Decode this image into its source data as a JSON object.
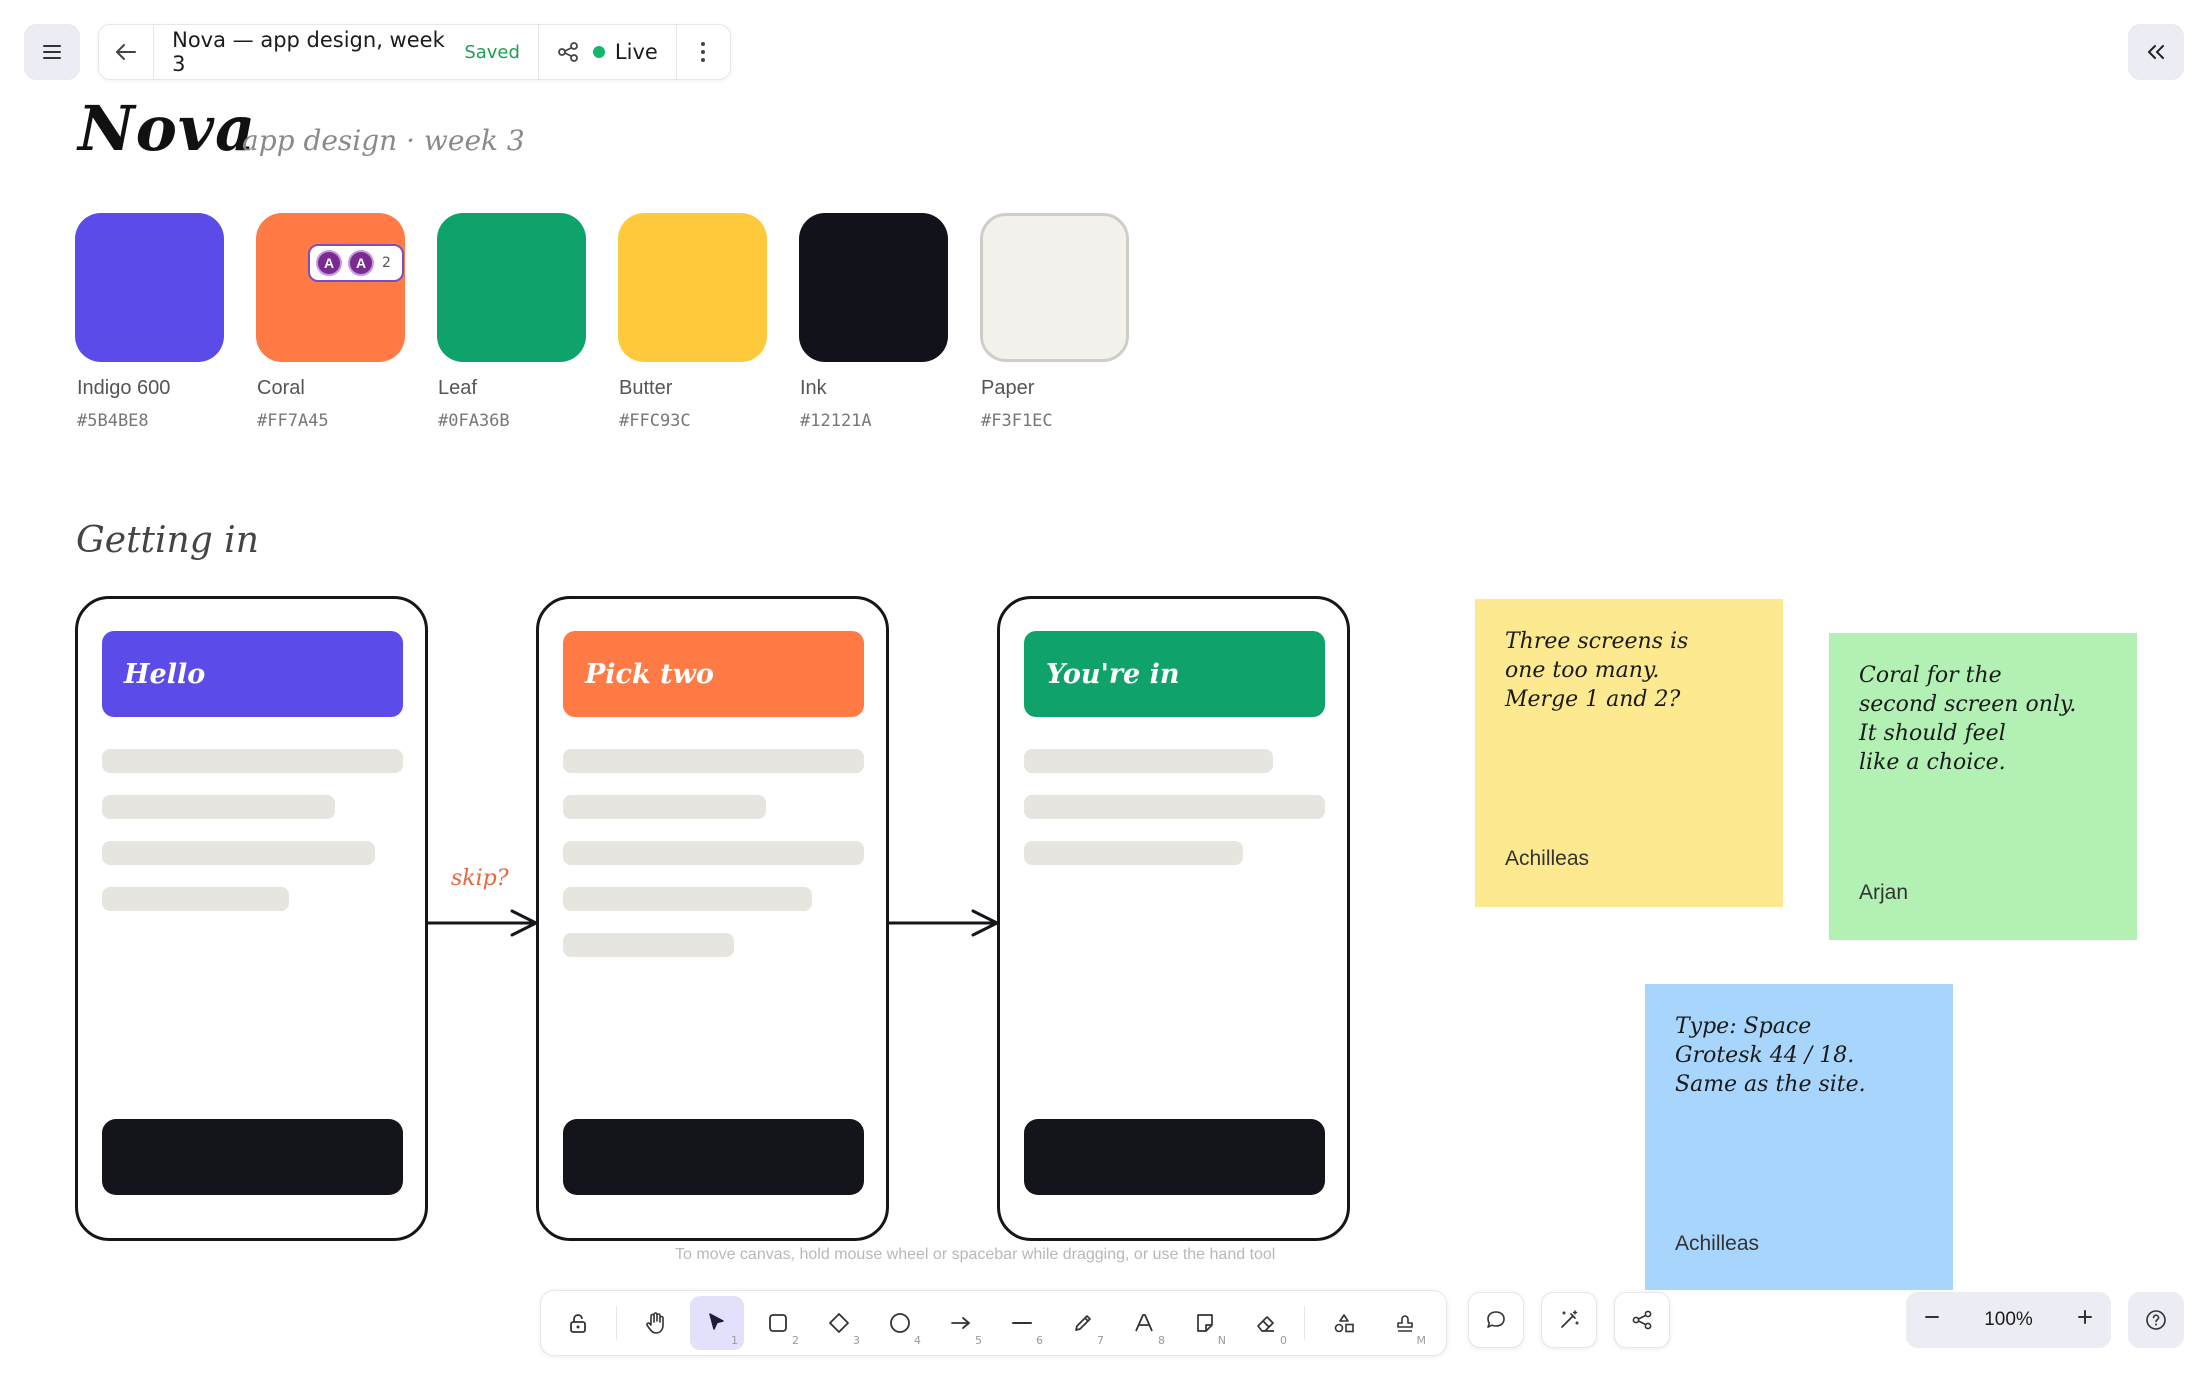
{
  "header": {
    "document_title": "Nova — app design, week 3",
    "save_status": "Saved",
    "live_label": "Live"
  },
  "canvas": {
    "title": "Nova",
    "subtitle": "app design · week 3",
    "section_heading": "Getting in",
    "swatches": [
      {
        "name": "Indigo 600",
        "hex": "#5B4BE8"
      },
      {
        "name": "Coral",
        "hex": "#FF7A45"
      },
      {
        "name": "Leaf",
        "hex": "#0FA36B"
      },
      {
        "name": "Butter",
        "hex": "#FFC93C"
      },
      {
        "name": "Ink",
        "hex": "#12121A"
      },
      {
        "name": "Paper",
        "hex": "#F3F1EC"
      }
    ],
    "collaborators": {
      "initials": [
        "A",
        "A"
      ],
      "count": "2"
    },
    "screens": [
      {
        "header": "Hello",
        "color": "#5B4BE8"
      },
      {
        "header": "Pick two",
        "color": "#FF7A45"
      },
      {
        "header": "You're in",
        "color": "#0FA36B"
      }
    ],
    "arrow_label": "skip?",
    "notes": [
      {
        "text": "Three screens is\none too many.\nMerge 1 and 2?",
        "author": "Achilleas",
        "color": "#FDE98F"
      },
      {
        "text": "Coral for the\nsecond screen only.\nIt should feel\nlike a choice.",
        "author": "Arjan",
        "color": "#B2F0B4"
      },
      {
        "text": "Type: Space\nGrotesk 44 / 18.\nSame as the site.",
        "author": "Achilleas",
        "color": "#A8D5FC"
      }
    ],
    "hint": "To move canvas, hold mouse wheel or spacebar while dragging, or use the hand tool"
  },
  "toolbar": {
    "tools": [
      {
        "icon": "lock-icon",
        "key": ""
      },
      {
        "icon": "hand-icon",
        "key": ""
      },
      {
        "icon": "pointer-icon",
        "key": "1"
      },
      {
        "icon": "rectangle-icon",
        "key": "2"
      },
      {
        "icon": "diamond-icon",
        "key": "3"
      },
      {
        "icon": "ellipse-icon",
        "key": "4"
      },
      {
        "icon": "arrow-icon",
        "key": "5"
      },
      {
        "icon": "line-icon",
        "key": "6"
      },
      {
        "icon": "pencil-icon",
        "key": "7"
      },
      {
        "icon": "text-icon",
        "key": "8"
      },
      {
        "icon": "image-icon",
        "key": "N"
      },
      {
        "icon": "eraser-icon",
        "key": "0"
      },
      {
        "icon": "shapes-library-icon",
        "key": ""
      },
      {
        "icon": "stamp-icon",
        "key": "M"
      }
    ],
    "active_tool": "pointer-icon"
  },
  "zoom": {
    "level": "100%"
  }
}
